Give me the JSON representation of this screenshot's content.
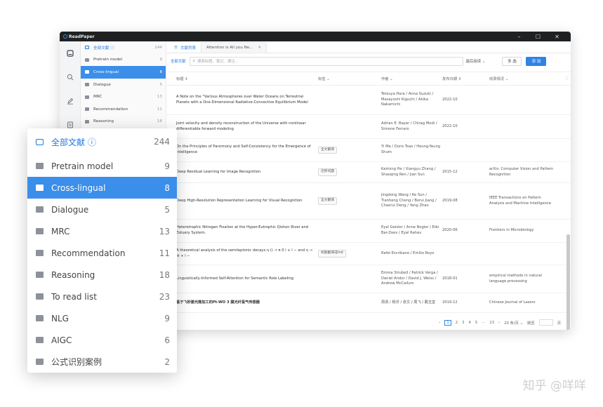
{
  "app": {
    "title": "ReadPaper",
    "window_controls": [
      "–",
      "☐",
      "✕"
    ]
  },
  "rail_icons": [
    "library-icon",
    "search-icon",
    "pen-icon",
    "notes-icon"
  ],
  "tree": {
    "items": [
      {
        "label": "全部文献 ⓘ",
        "count": "244"
      },
      {
        "label": "Pretrain model",
        "count": "9"
      },
      {
        "label": "Cross-lingual",
        "count": "8"
      },
      {
        "label": "Dialogue",
        "count": "5"
      },
      {
        "label": "MRC",
        "count": "13"
      },
      {
        "label": "Recommendation",
        "count": "11"
      },
      {
        "label": "Reasoning",
        "count": "18"
      }
    ]
  },
  "tabs": [
    {
      "label": "文献列表"
    },
    {
      "label": "Attention is All you Ne..."
    }
  ],
  "toolbar": {
    "label": "全部文献",
    "search_placeholder": "搜索标题、笔记、摘注...",
    "sort_label": "最后阅读 ⌄",
    "multi_label": "多 选",
    "add_label": "添 加"
  },
  "table": {
    "headers": {
      "title": "标题 ⇕",
      "tag": "标签 ⌄",
      "author": "作者 ⌄",
      "date": "发布日期 ⇕",
      "source": "收录情况 ⌄"
    },
    "rows": [
      {
        "title": "A Note on the \"Various Atmospheres over Water Oceans on Terrestrial Planets with a One-Dimensional Radiative-Convective Equilibrium Model",
        "tag": "",
        "author": "Tetsuya Hara / Anna Suzuki / Masayoshi Kiguchi / Akika Nakamichi",
        "date": "2022-10",
        "source": ""
      },
      {
        "title": "Joint velocity and density reconstruction of the Universe with nonlinear differentiable forward modeling",
        "tag": "",
        "author": "Adrian E. Bayer / Chirag Modi / Simone Ferraro",
        "date": "2022-10",
        "source": ""
      },
      {
        "title": "On the Principles of Parsimony and Self-Consistency for the Emergence of Intelligence",
        "tag": "全文翻译",
        "author": "Yi Ma / Doris Tsao / Heung-Yeung Shum",
        "date": "",
        "source": ""
      },
      {
        "title": "Deep Residual Learning for Image Recognition",
        "tag": "迁移问题",
        "author": "Kaiming He / Xiangyu Zhang / Shaoqing Ren / Jian Sun",
        "date": "2015-12",
        "source": "arXiv: Computer Vision and Pattern Recognition"
      },
      {
        "title": "Deep High-Resolution Representation Learning for Visual Recognition",
        "tag": "全文翻译",
        "author": "Jingdong Wang / Ke Sun / Tianheng Cheng / Borui Jiang / Chaorui Deng / Yang Zhao",
        "date": "2019-08",
        "source": "IEEE Transactions on Pattern Analysis and Machine Intelligence"
      },
      {
        "title": "Heterotrophic Nitrogen Fixation at the Hyper-Eutrophic Qishon River and Estuary System.",
        "tag": "",
        "author": "Eyal Geisler / Anne Bogler / Edo Bar-Zeev / Eyal Rahav",
        "date": "2020-06",
        "source": "Frontiers in Microbiology"
      },
      {
        "title": "A theoretical analysis of the semileptonic decays η () → π 0 l + l − and η → πl + l −",
        "tag": "标题翻译成md",
        "author": "Rafel Escribano / Emilio Royo",
        "date": "",
        "source": ""
      },
      {
        "title": "Linguistically-Informed Self-Attention for Semantic Role Labeling",
        "tag": "",
        "author": "Emma Strubell / Patrick Verga / Daniel Andor / David J. Weiss / Andrew McCallum",
        "date": "2018-01",
        "source": "empirical methods in natural language processing"
      },
      {
        "title": "基于飞秒激光微加工的Pt-WO 3 膜光纤氢气传感器",
        "tag": "",
        "author": "周贤 / 杨洋 / 张文 / 周飞 / 戴玉堂",
        "date": "2019-12",
        "source": "Chinese Journal of Lasers"
      }
    ]
  },
  "pager": {
    "pages": [
      "‹",
      "1",
      "2",
      "3",
      "4",
      "5",
      "···",
      "13",
      "›"
    ],
    "page_size": "20 条/页 ⌄",
    "goto": "跳至",
    "page_suffix": "页"
  },
  "popout": {
    "items": [
      {
        "label": "全部文献 ⓘ",
        "count": "244"
      },
      {
        "label": "Pretrain model",
        "count": "9"
      },
      {
        "label": "Cross-lingual",
        "count": "8"
      },
      {
        "label": "Dialogue",
        "count": "5"
      },
      {
        "label": "MRC",
        "count": "13"
      },
      {
        "label": "Recommendation",
        "count": "11"
      },
      {
        "label": "Reasoning",
        "count": "18"
      },
      {
        "label": "To read list",
        "count": "23"
      },
      {
        "label": "NLG",
        "count": "9"
      },
      {
        "label": "AIGC",
        "count": "6"
      },
      {
        "label": "公式识别案例",
        "count": "2"
      }
    ]
  },
  "watermark": "知乎 @咩咩"
}
